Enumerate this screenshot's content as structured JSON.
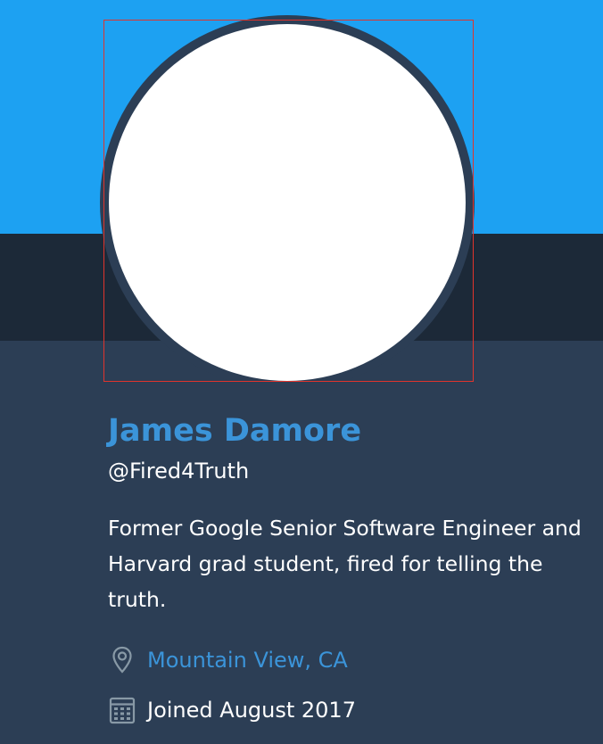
{
  "colors": {
    "banner": "#1da1f2",
    "nav_strip": "#1c2938",
    "panel": "#2c3e55",
    "avatar_ring": "#2c3e55",
    "avatar_fill": "#ffffff",
    "link": "#3b94d9",
    "icon_muted": "#8899a6",
    "text": "#ffffff"
  },
  "profile": {
    "name": "James Damore",
    "handle": "@Fired4Truth",
    "bio": "Former Google Senior Software Engineer and Harvard grad student, fired for telling the truth.",
    "location": "Mountain View, CA",
    "location_icon": "location-pin-icon",
    "joined": "Joined August 2017",
    "joined_icon": "calendar-icon"
  }
}
